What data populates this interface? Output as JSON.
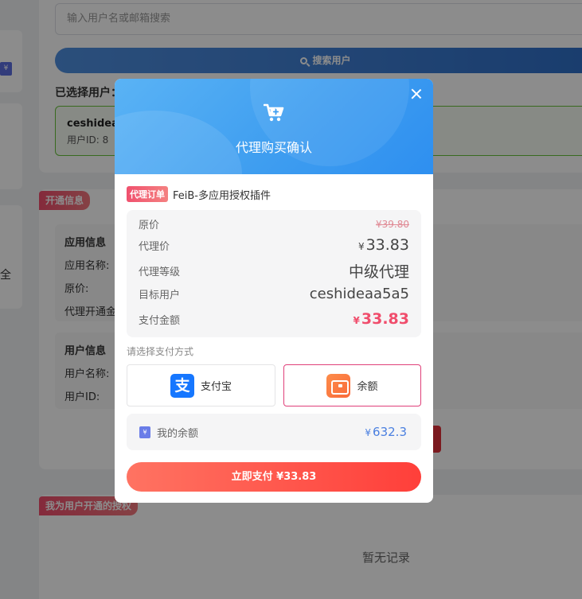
{
  "background": {
    "search_placeholder": "输入用户名或邮箱搜索",
    "search_button": "搜索用户",
    "selected_user_label": "已选择用户：",
    "selected_user_name": "ceshideaa",
    "selected_user_id": "用户ID: 8",
    "section_open_info": "开通信息",
    "app_info_title": "应用信息",
    "app_name_label": "应用名称:",
    "orig_price_label": "原价:",
    "agent_open_label": "代理开通金",
    "user_info_title": "用户信息",
    "user_name_label": "用户名称:",
    "user_id_label": "用户ID:",
    "section_opened_for_users": "我为用户开通的授权",
    "empty_text": "暂无记录",
    "side_char": "全",
    "side_badge": "¥"
  },
  "modal": {
    "title": "代理购买确认",
    "order_tag": "代理订单",
    "product_name": "FeiB-多应用授权插件",
    "rows": {
      "original_label": "原价",
      "original_value": "¥39.80",
      "agent_label": "代理价",
      "agent_value": "33.83",
      "level_label": "代理等级",
      "level_value": "中级代理",
      "target_label": "目标用户",
      "target_value": "ceshideaa5a5",
      "pay_label": "支付金额",
      "pay_value": "33.83"
    },
    "currency": "¥",
    "payment_method_label": "请选择支付方式",
    "payment_options": [
      {
        "label": "支付宝",
        "icon": "alipay-icon",
        "selected": false
      },
      {
        "label": "余额",
        "icon": "wallet-icon",
        "selected": true
      }
    ],
    "alipay_glyph": "支",
    "balance_badge": "¥",
    "balance_label": "我的余额",
    "balance_value": "632.3",
    "pay_button": "立即支付  ¥33.83"
  },
  "colors": {
    "header_blue": "#3f9ef0",
    "accent_red": "#f04d6c",
    "balance_blue": "#4a7fe0",
    "selected_border": "#e0407a"
  }
}
